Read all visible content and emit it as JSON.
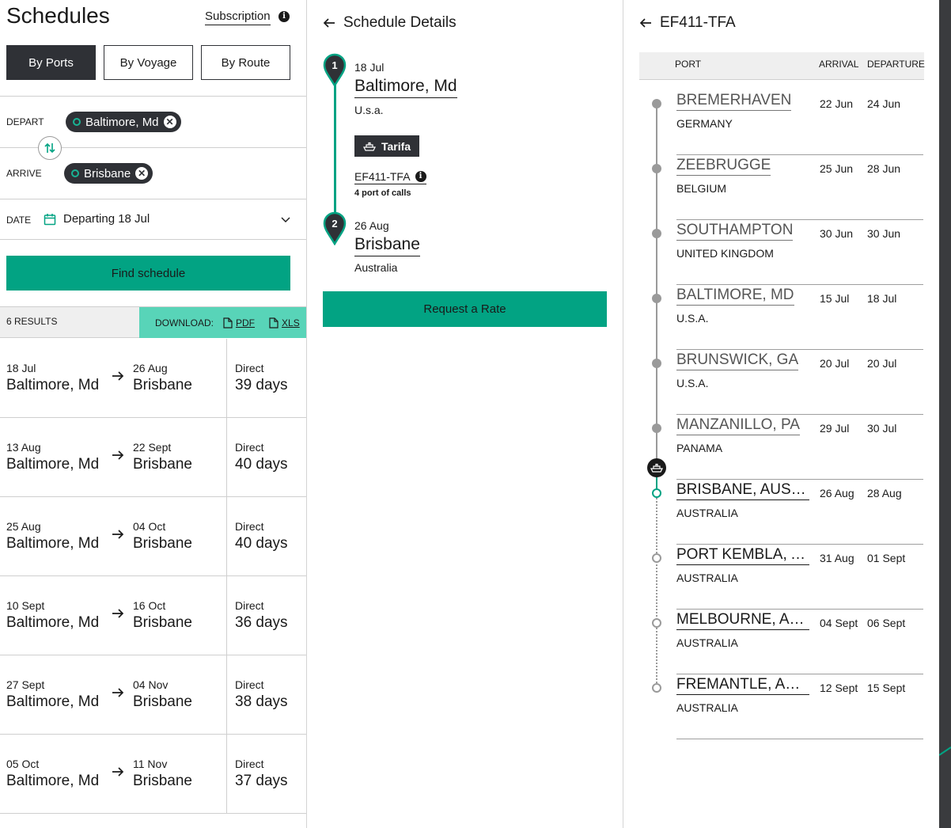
{
  "schedules": {
    "title": "Schedules",
    "subscription_label": "Subscription",
    "modes": [
      "By Ports",
      "By Voyage",
      "By Route"
    ],
    "active_mode": "By Ports",
    "depart_label": "DEPART",
    "depart_value": "Baltimore, Md",
    "arrive_label": "ARRIVE",
    "arrive_value": "Brisbane",
    "date_label": "DATE",
    "date_value": "Departing 18 Jul",
    "find_button": "Find schedule",
    "results_count": "6 RESULTS",
    "download_label": "DOWNLOAD:",
    "pdf_label": "PDF",
    "xls_label": "XLS",
    "results": [
      {
        "depart_date": "18 Jul",
        "origin": "Baltimore, Md",
        "arrive_date": "26 Aug",
        "destination": "Brisbane",
        "service": "Direct",
        "duration": "39 days"
      },
      {
        "depart_date": "13 Aug",
        "origin": "Baltimore, Md",
        "arrive_date": "22 Sept",
        "destination": "Brisbane",
        "service": "Direct",
        "duration": "40 days"
      },
      {
        "depart_date": "25 Aug",
        "origin": "Baltimore, Md",
        "arrive_date": "04 Oct",
        "destination": "Brisbane",
        "service": "Direct",
        "duration": "40 days"
      },
      {
        "depart_date": "10 Sept",
        "origin": "Baltimore, Md",
        "arrive_date": "16 Oct",
        "destination": "Brisbane",
        "service": "Direct",
        "duration": "36 days"
      },
      {
        "depart_date": "27 Sept",
        "origin": "Baltimore, Md",
        "arrive_date": "04 Nov",
        "destination": "Brisbane",
        "service": "Direct",
        "duration": "38 days"
      },
      {
        "depart_date": "05 Oct",
        "origin": "Baltimore, Md",
        "arrive_date": "11 Nov",
        "destination": "Brisbane",
        "service": "Direct",
        "duration": "37 days"
      }
    ]
  },
  "details": {
    "title": "Schedule Details",
    "stops": [
      {
        "number": "1",
        "date": "18 Jul",
        "port": "Baltimore, Md",
        "country": "U.s.a."
      },
      {
        "number": "2",
        "date": "26 Aug",
        "port": "Brisbane",
        "country": "Australia"
      }
    ],
    "vessel": "Tarifa",
    "voyage": "EF411-TFA",
    "calls": "4 port of calls",
    "rate_button": "Request a Rate"
  },
  "voyage": {
    "title": "EF411-TFA",
    "col_port": "PORT",
    "col_arrival": "ARRIVAL",
    "col_departure": "DEPARTURE",
    "ports": [
      {
        "name": "BREMERHAVEN",
        "country": "GERMANY",
        "arrival": "22 Jun",
        "departure": "24 Jun",
        "status": "past"
      },
      {
        "name": "ZEEBRUGGE",
        "country": "BELGIUM",
        "arrival": "25 Jun",
        "departure": "28 Jun",
        "status": "past"
      },
      {
        "name": "SOUTHAMPTON",
        "country": "UNITED KINGDOM",
        "arrival": "30 Jun",
        "departure": "30 Jun",
        "status": "past"
      },
      {
        "name": "BALTIMORE, MD",
        "country": "U.S.A.",
        "arrival": "15 Jul",
        "departure": "18 Jul",
        "status": "past"
      },
      {
        "name": "BRUNSWICK, GA",
        "country": "U.S.A.",
        "arrival": "20 Jul",
        "departure": "20 Jul",
        "status": "past"
      },
      {
        "name": "MANZANILLO, PA",
        "country": "PANAMA",
        "arrival": "29 Jul",
        "departure": "30 Jul",
        "status": "past"
      },
      {
        "name": "BRISBANE, AUSTRALIA",
        "country": "AUSTRALIA",
        "arrival": "26 Aug",
        "departure": "28 Aug",
        "status": "next"
      },
      {
        "name": "PORT KEMBLA, AUSTRALIA",
        "country": "AUSTRALIA",
        "arrival": "31 Aug",
        "departure": "01 Sept",
        "status": "future"
      },
      {
        "name": "MELBOURNE, AUSTRALIA",
        "country": "AUSTRALIA",
        "arrival": "04 Sept",
        "departure": "06 Sept",
        "status": "future"
      },
      {
        "name": "FREMANTLE, AUSTRALIA",
        "country": "AUSTRALIA",
        "arrival": "12 Sept",
        "departure": "15 Sept",
        "status": "future"
      }
    ]
  },
  "colors": {
    "accent": "#02a383",
    "accent_light": "#58d4b8",
    "dark": "#2f3136",
    "muted": "#9a9a9a"
  }
}
